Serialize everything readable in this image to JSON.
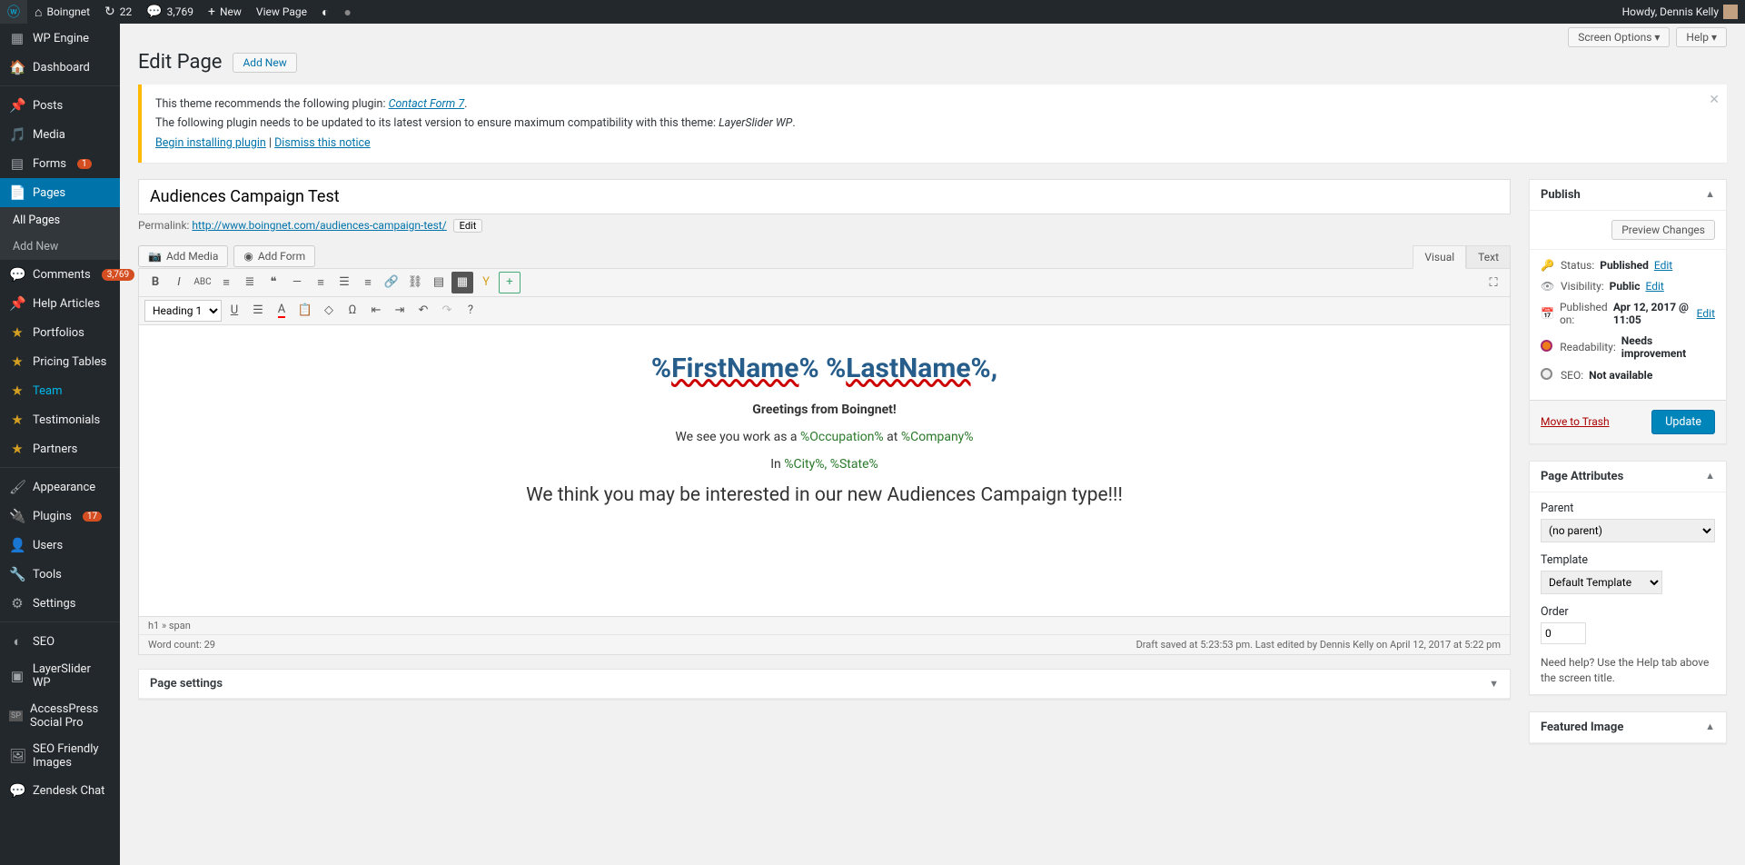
{
  "toolbar": {
    "site": "Boingnet",
    "updates": "22",
    "comments": "3,769",
    "new": "New",
    "viewpage": "View Page",
    "howdy": "Howdy, Dennis Kelly"
  },
  "sidebar": {
    "wpengine": "WP Engine",
    "dashboard": "Dashboard",
    "posts": "Posts",
    "media": "Media",
    "forms": "Forms",
    "forms_badge": "1",
    "pages": "Pages",
    "allpages": "All Pages",
    "addnew": "Add New",
    "comments": "Comments",
    "comments_badge": "3,769",
    "help": "Help Articles",
    "portfolios": "Portfolios",
    "pricing": "Pricing Tables",
    "team": "Team",
    "testimonials": "Testimonials",
    "partners": "Partners",
    "appearance": "Appearance",
    "plugins": "Plugins",
    "plugins_badge": "17",
    "users": "Users",
    "tools": "Tools",
    "settings": "Settings",
    "seo": "SEO",
    "layerslider": "LayerSlider WP",
    "accesspress": "AccessPress Social Pro",
    "seofriendly": "SEO Friendly Images",
    "zendesk": "Zendesk Chat"
  },
  "header": {
    "title": "Edit Page",
    "addnew": "Add New",
    "screen": "Screen Options",
    "helpbtn": "Help"
  },
  "notice": {
    "l1a": "This theme recommends the following plugin: ",
    "l1b": "Contact Form 7",
    "l2a": "The following plugin needs to be updated to its latest version to ensure maximum compatibility with this theme: ",
    "l2b": "LayerSlider WP",
    "l3a": "Begin installing plugin",
    "l3b": "Dismiss this notice"
  },
  "page": {
    "title_value": "Audiences Campaign Test",
    "permalink_label": "Permalink:",
    "permalink_base": "http://www.boingnet.com/",
    "permalink_slug": "audiences-campaign-test/",
    "edit": "Edit",
    "addmedia": "Add Media",
    "addform": "Add Form",
    "tab_visual": "Visual",
    "tab_text": "Text",
    "format_sel": "Heading 1"
  },
  "body": {
    "h1_a": "%",
    "h1_b": "FirstName",
    "h1_c": "% %",
    "h1_d": "LastName",
    "h1_e": "%,",
    "greet": "Greetings from Boingnet!",
    "p1a": "We see you work as a ",
    "p1b": "%Occupation%",
    "p1c": " at ",
    "p1d": "%Company%",
    "p2a": "In ",
    "p2b": "%City%, %State%",
    "p3": "We think you may be interested in our new Audiences Campaign type!!!"
  },
  "footer": {
    "path": "h1 » span",
    "wc": "Word count: 29",
    "draft": "Draft saved at 5:23:53 pm. Last edited by Dennis Kelly on April 12, 2017 at 5:22 pm"
  },
  "panel_settings": "Page settings",
  "publish": {
    "title": "Publish",
    "preview": "Preview Changes",
    "status_l": "Status:",
    "status_v": "Published",
    "vis_l": "Visibility:",
    "vis_v": "Public",
    "pub_l": "Published on:",
    "pub_v": "Apr 12, 2017 @ 11:05",
    "read_l": "Readability:",
    "read_v": "Needs improvement",
    "seo_l": "SEO:",
    "seo_v": "Not available",
    "edit": "Edit",
    "trash": "Move to Trash",
    "update": "Update"
  },
  "attrs": {
    "title": "Page Attributes",
    "parent": "Parent",
    "parent_v": "(no parent)",
    "template": "Template",
    "template_v": "Default Template",
    "order": "Order",
    "order_v": "0",
    "help": "Need help? Use the Help tab above the screen title."
  },
  "feat": {
    "title": "Featured Image"
  }
}
